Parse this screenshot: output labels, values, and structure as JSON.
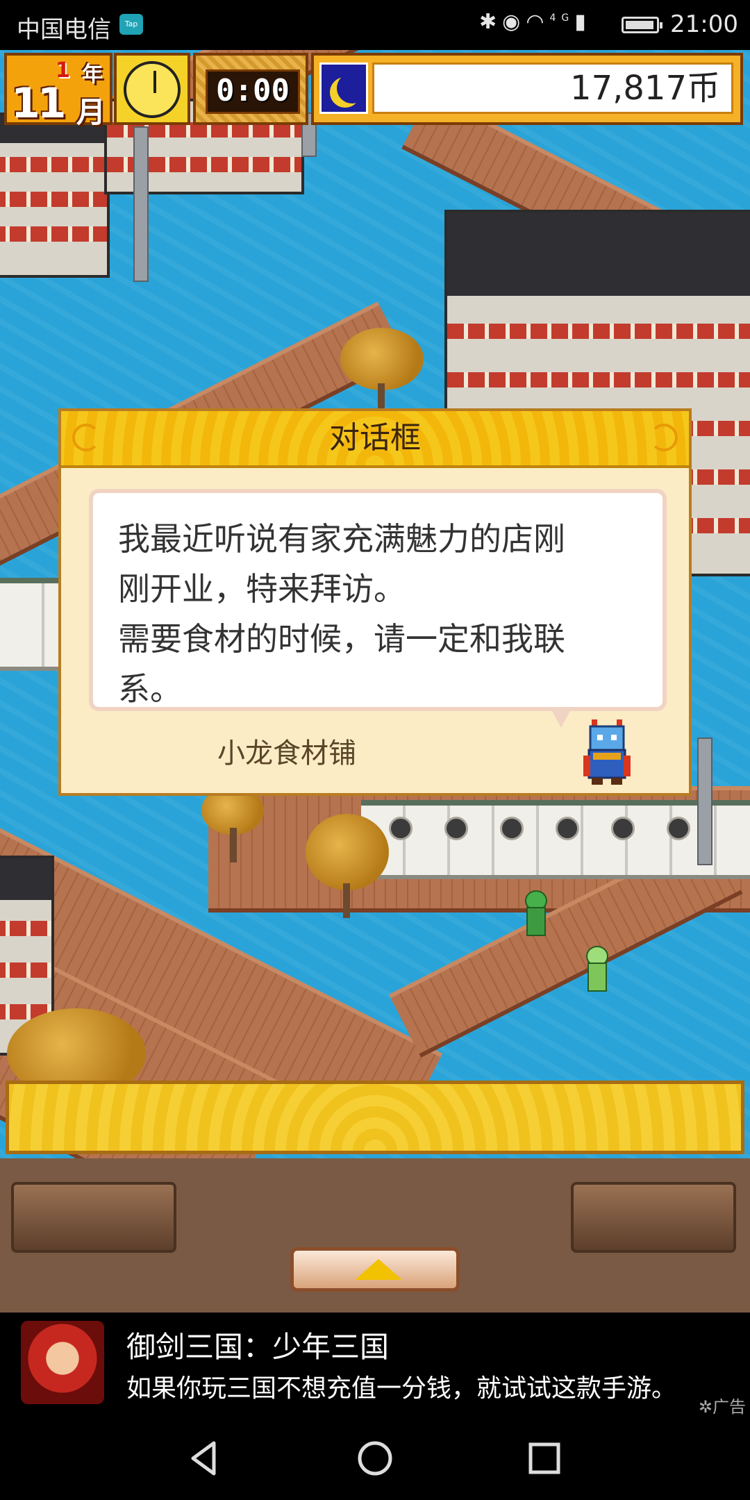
{
  "status_bar": {
    "carrier": "中国电信",
    "tap_badge": "Tap",
    "signal_label": "4G",
    "time": "21:00"
  },
  "hud": {
    "year_number": "1",
    "year_char": "年",
    "month_number": "11",
    "month_char": "月",
    "time_display": "0:00",
    "coins": "17,817币",
    "night_icon": "moon-icon"
  },
  "dialog": {
    "title": "对话框",
    "message_line1": "我最近听说有家充满魅力的店刚",
    "message_line2": "刚开业，特来拜访。",
    "message_line3": "需要食材的时候，请一定和我联",
    "message_line4": "系。",
    "speaker": "小龙食材铺"
  },
  "ad": {
    "title": "御剑三国：少年三国",
    "text": "如果你玩三国不想充值一分钱，就试试这款手游。",
    "label": "广告"
  },
  "colors": {
    "water": "#2aa4d8",
    "hud_gold": "#f5b227",
    "dialog_title": "#f6c71b"
  }
}
